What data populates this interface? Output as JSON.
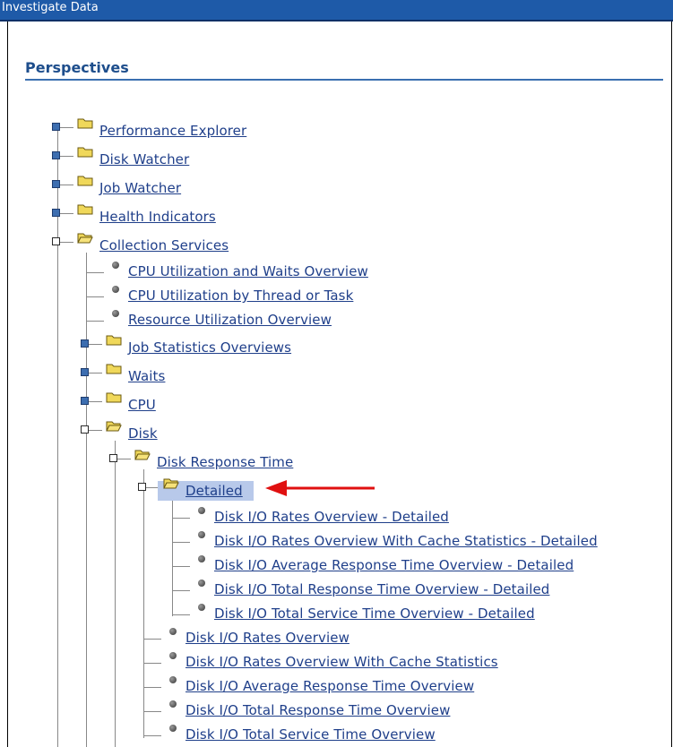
{
  "window": {
    "title": "Investigate Data"
  },
  "section": {
    "heading": "Perspectives"
  },
  "tree": [
    {
      "label": "Performance Explorer",
      "type": "folder",
      "state": "collapsed"
    },
    {
      "label": "Disk Watcher",
      "type": "folder",
      "state": "collapsed"
    },
    {
      "label": "Job Watcher",
      "type": "folder",
      "state": "collapsed"
    },
    {
      "label": "Health Indicators",
      "type": "folder",
      "state": "collapsed"
    },
    {
      "label": "Collection Services",
      "type": "folder",
      "state": "expanded"
    },
    {
      "label": "CPU Utilization and Waits Overview",
      "type": "item"
    },
    {
      "label": "CPU Utilization by Thread or Task",
      "type": "item"
    },
    {
      "label": "Resource Utilization Overview",
      "type": "item"
    },
    {
      "label": "Job Statistics Overviews",
      "type": "folder",
      "state": "collapsed"
    },
    {
      "label": "Waits",
      "type": "folder",
      "state": "collapsed"
    },
    {
      "label": "CPU",
      "type": "folder",
      "state": "collapsed"
    },
    {
      "label": "Disk",
      "type": "folder",
      "state": "expanded"
    },
    {
      "label": "Disk Response Time",
      "type": "folder",
      "state": "expanded"
    },
    {
      "label": "Detailed",
      "type": "folder",
      "state": "expanded",
      "selected": true
    },
    {
      "label": "Disk I/O Rates Overview - Detailed",
      "type": "item"
    },
    {
      "label": "Disk I/O Rates Overview With Cache Statistics - Detailed",
      "type": "item"
    },
    {
      "label": "Disk I/O Average Response Time Overview - Detailed",
      "type": "item"
    },
    {
      "label": "Disk I/O Total Response Time Overview - Detailed",
      "type": "item"
    },
    {
      "label": "Disk I/O Total Service Time Overview - Detailed",
      "type": "item"
    },
    {
      "label": "Disk I/O Rates Overview",
      "type": "item"
    },
    {
      "label": "Disk I/O Rates Overview With Cache Statistics",
      "type": "item"
    },
    {
      "label": "Disk I/O Average Response Time Overview",
      "type": "item"
    },
    {
      "label": "Disk I/O Total Response Time Overview",
      "type": "item"
    },
    {
      "label": "Disk I/O Total Service Time Overview",
      "type": "item"
    }
  ],
  "colors": {
    "title_bar": "#1e5aa8",
    "link": "#1f3f8a",
    "selection": "#b8c9ea",
    "annotation_arrow": "#e01010"
  }
}
